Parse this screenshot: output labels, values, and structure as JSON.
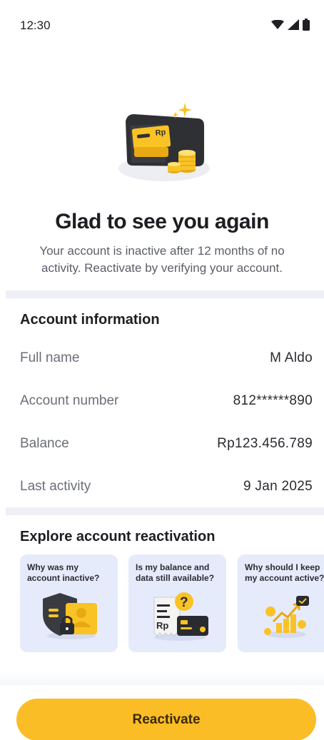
{
  "status_bar": {
    "time": "12:30",
    "icons": [
      "wifi-icon",
      "signal-icon",
      "battery-icon"
    ]
  },
  "hero": {
    "headline": "Glad to see you again",
    "subtext": "Your account is inactive after 12 months of no activity. Reactivate by verifying your account.",
    "illustration": "wallet-coins-illustration",
    "illustration_text": "Rp"
  },
  "account_info": {
    "title": "Account information",
    "rows": [
      {
        "label": "Full name",
        "value": "M Aldo"
      },
      {
        "label": "Account number",
        "value": "812******890"
      },
      {
        "label": "Balance",
        "value": "Rp123.456.789"
      },
      {
        "label": "Last activity",
        "value": "9 Jan 2025"
      }
    ]
  },
  "explore": {
    "title": "Explore account reactivation",
    "cards": [
      {
        "title": "Why was my\naccount inactive?",
        "icon": "shield-lock-icon"
      },
      {
        "title": "Is my balance and\ndata still available?",
        "icon": "receipt-card-question-icon",
        "icon_text": "Rp"
      },
      {
        "title": "Why should I keep\nmy account active?",
        "icon": "growth-chart-coins-icon"
      }
    ]
  },
  "cta": {
    "label": "Reactivate"
  },
  "colors": {
    "accent": "#fbbd26",
    "card_bg": "#e6ebfb",
    "divider": "#eef0f5",
    "text_primary": "#1d1d22",
    "text_secondary": "#6b6e78"
  }
}
